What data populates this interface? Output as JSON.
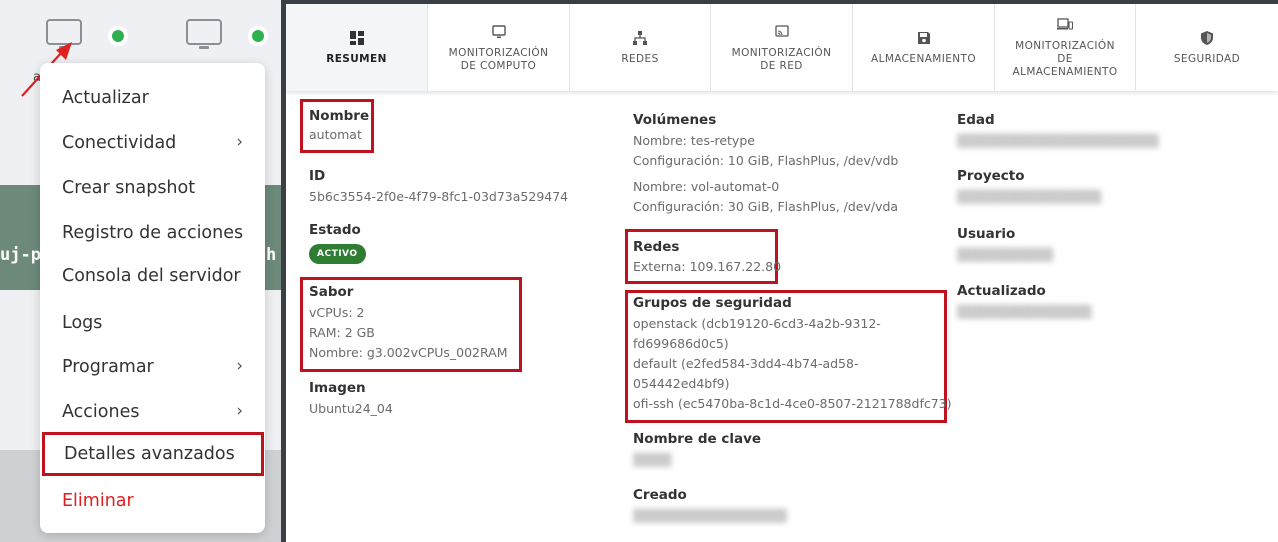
{
  "background": {
    "partial_label_letter": "a",
    "partial_row_text_left": "uj-pr",
    "partial_row_text_right": "h"
  },
  "context_menu": {
    "items": [
      {
        "label": "Actualizar",
        "has_submenu": false
      },
      {
        "label": "Conectividad",
        "has_submenu": true
      },
      {
        "label": "Crear snapshot",
        "has_submenu": false
      },
      {
        "label": "Registro de acciones",
        "has_submenu": false
      },
      {
        "label": "Consola del servidor",
        "has_submenu": false
      },
      {
        "label": "Logs",
        "has_submenu": false
      },
      {
        "label": "Programar",
        "has_submenu": true
      },
      {
        "label": "Acciones",
        "has_submenu": true
      },
      {
        "label": "Detalles avanzados",
        "has_submenu": false,
        "highlighted": true
      },
      {
        "label": "Eliminar",
        "has_submenu": false,
        "danger": true
      }
    ],
    "chevron": "›"
  },
  "tabs": [
    {
      "label_lines": [
        "RESUMEN"
      ],
      "icon": "grid-icon",
      "active": true
    },
    {
      "label_lines": [
        "MONITORIZACIÓN",
        "DE COMPUTO"
      ],
      "icon": "monitor-icon"
    },
    {
      "label_lines": [
        "REDES"
      ],
      "icon": "network-icon"
    },
    {
      "label_lines": [
        "MONITORIZACIÓN",
        "DE RED"
      ],
      "icon": "cast-icon"
    },
    {
      "label_lines": [
        "ALMACENAMIENTO"
      ],
      "icon": "floppy-icon"
    },
    {
      "label_lines": [
        "MONITORIZACIÓN",
        "DE",
        "ALMACENAMIENTO"
      ],
      "icon": "devices-icon"
    },
    {
      "label_lines": [
        "SEGURIDAD"
      ],
      "icon": "shield-icon"
    }
  ],
  "summary": {
    "nombre": {
      "title": "Nombre",
      "value": "automat"
    },
    "id": {
      "title": "ID",
      "value": "5b6c3554-2f0e-4f79-8fc1-03d73a529474"
    },
    "estado": {
      "title": "Estado",
      "badge": "ACTIVO"
    },
    "sabor": {
      "title": "Sabor",
      "lines": [
        "vCPUs: 2",
        "RAM: 2 GB",
        "Nombre: g3.002vCPUs_002RAM"
      ]
    },
    "imagen": {
      "title": "Imagen",
      "value": "Ubuntu24_04"
    },
    "volumenes": {
      "title": "Volúmenes",
      "lines": [
        "Nombre: tes-retype",
        "Configuración: 10 GiB, FlashPlus, /dev/vdb",
        "Nombre: vol-automat-0",
        "Configuración: 30 GiB, FlashPlus, /dev/vda"
      ]
    },
    "redes": {
      "title": "Redes",
      "value": "Externa: 109.167.22.80"
    },
    "grupos_seguridad": {
      "title": "Grupos de seguridad",
      "lines": [
        "openstack (dcb19120-6cd3-4a2b-9312-",
        "fd699686d0c5)",
        "default (e2fed584-3dd4-4b74-ad58-",
        "054442ed4bf9)",
        "ofi-ssh (ec5470ba-8c1d-4ce0-8507-2121788dfc73)"
      ]
    },
    "nombre_clave": {
      "title": "Nombre de clave",
      "value": "▒▒▒▒"
    },
    "creado": {
      "title": "Creado",
      "value": "▒▒▒▒▒▒▒▒▒▒▒▒▒▒▒▒"
    },
    "edad": {
      "title": "Edad",
      "value": "▒▒▒▒▒▒▒▒▒▒▒▒▒▒▒▒▒▒▒▒▒"
    },
    "proyecto": {
      "title": "Proyecto",
      "value": "▒▒▒▒▒▒▒▒▒▒▒▒▒▒▒"
    },
    "usuario": {
      "title": "Usuario",
      "value": "▒▒▒▒▒▒▒▒▒▒"
    },
    "actualizado": {
      "title": "Actualizado",
      "value": "▒▒▒▒▒▒▒▒▒▒▒▒▒▒"
    }
  },
  "colors": {
    "highlight_box": "#c0121e",
    "status_green": "#2fb04f",
    "badge_green": "#2f7d32",
    "danger_text": "#e01e1e",
    "panel_border": "#3a3f46"
  }
}
